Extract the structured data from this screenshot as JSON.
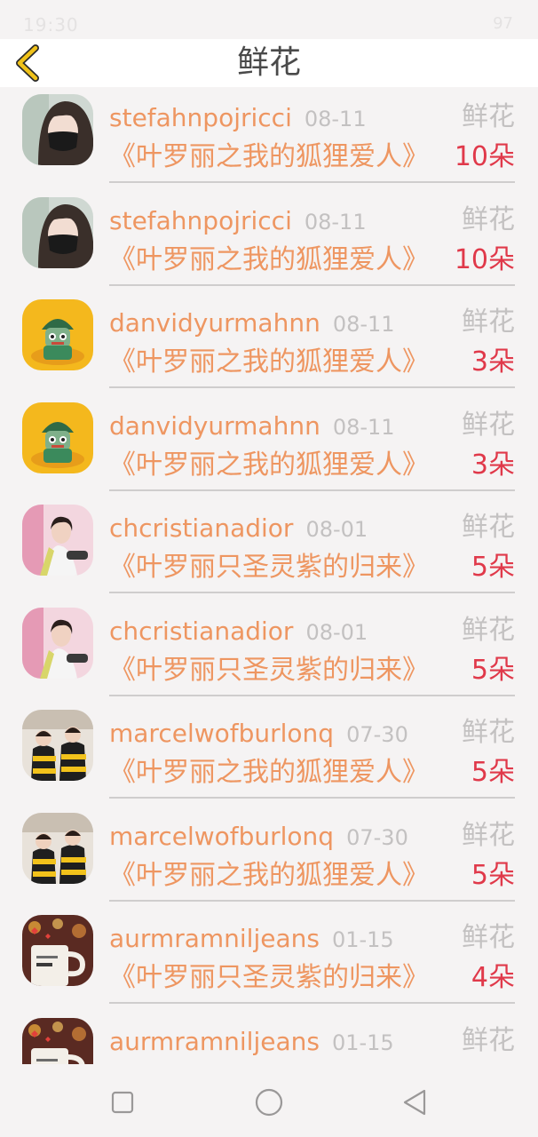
{
  "status": {
    "time": "19:30",
    "battery": "97"
  },
  "header": {
    "title": "鲜花",
    "back_icon": "chevron-left-icon",
    "back_color": "#f0c21a"
  },
  "colors": {
    "accent": "#ee9661",
    "count": "#e0394a",
    "muted": "#c3c1c1"
  },
  "rows": [
    {
      "user": "stefahnpojricci",
      "date": "08-11",
      "kind": "鲜花",
      "book": "《叶罗丽之我的狐狸爱人》",
      "count": "10朵",
      "avatar": "girl-mask-avatar"
    },
    {
      "user": "stefahnpojricci",
      "date": "08-11",
      "kind": "鲜花",
      "book": "《叶罗丽之我的狐狸爱人》",
      "count": "10朵",
      "avatar": "girl-mask-avatar"
    },
    {
      "user": "danvidyurmahnn",
      "date": "08-11",
      "kind": "鲜花",
      "book": "《叶罗丽之我的狐狸爱人》",
      "count": "3朵",
      "avatar": "cartoon-avatar"
    },
    {
      "user": "danvidyurmahnn",
      "date": "08-11",
      "kind": "鲜花",
      "book": "《叶罗丽之我的狐狸爱人》",
      "count": "3朵",
      "avatar": "cartoon-avatar"
    },
    {
      "user": "chcristianadior",
      "date": "08-01",
      "kind": "鲜花",
      "book": "《叶罗丽只圣灵紫的归来》",
      "count": "5朵",
      "avatar": "woman-photo-avatar"
    },
    {
      "user": "chcristianadior",
      "date": "08-01",
      "kind": "鲜花",
      "book": "《叶罗丽只圣灵紫的归来》",
      "count": "5朵",
      "avatar": "woman-photo-avatar"
    },
    {
      "user": "marcelwofburlonq",
      "date": "07-30",
      "kind": "鲜花",
      "book": "《叶罗丽之我的狐狸爱人》",
      "count": "5朵",
      "avatar": "couple-photo-avatar"
    },
    {
      "user": "marcelwofburlonq",
      "date": "07-30",
      "kind": "鲜花",
      "book": "《叶罗丽之我的狐狸爱人》",
      "count": "5朵",
      "avatar": "couple-photo-avatar"
    },
    {
      "user": "aurmramniljeans",
      "date": "01-15",
      "kind": "鲜花",
      "book": "《叶罗丽只圣灵紫的归来》",
      "count": "4朵",
      "avatar": "mug-photo-avatar"
    },
    {
      "user": "aurmramniljeans",
      "date": "01-15",
      "kind": "鲜花",
      "book": "",
      "count": "",
      "avatar": "mug-photo-avatar"
    }
  ],
  "navbar": {
    "items": [
      "square-recents-icon",
      "circle-home-icon",
      "triangle-back-icon"
    ]
  }
}
